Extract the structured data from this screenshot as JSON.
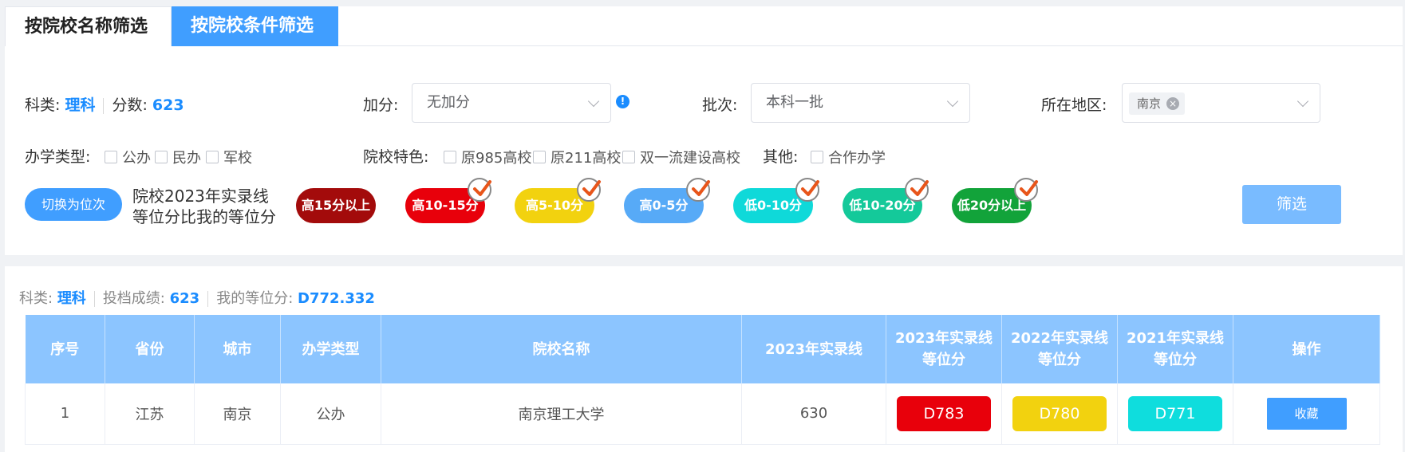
{
  "tabs": [
    "按院校名称筛选",
    "按院校条件筛选"
  ],
  "filters": {
    "subject_label": "科类:",
    "subject_value": "理科",
    "score_label": "分数:",
    "score_value": "623",
    "bonus_label": "加分:",
    "bonus_value": "无加分",
    "batch_label": "批次:",
    "batch_value": "本科一批",
    "region_label": "所在地区:",
    "region_tag": "南京",
    "school_type_label": "办学类型:",
    "school_types": [
      "公办",
      "民办",
      "军校"
    ],
    "feature_label": "院校特色:",
    "features": [
      "原985高校",
      "原211高校",
      "双一流建设高校"
    ],
    "other_label": "其他:",
    "others": [
      "合作办学"
    ]
  },
  "switch_button": "切换为位次",
  "description": [
    "院校2023年实录线",
    "等位分比我的等位分"
  ],
  "chips": [
    {
      "label": "高15分以上",
      "color": "#a30b0b",
      "checked": false
    },
    {
      "label": "高10-15分",
      "color": "#e8000b",
      "checked": true
    },
    {
      "label": "高5-10分",
      "color": "#f2d20f",
      "checked": true
    },
    {
      "label": "高0-5分",
      "color": "#57aaf7",
      "checked": true
    },
    {
      "label": "低0-10分",
      "color": "#0fd9d9",
      "checked": true
    },
    {
      "label": "低10-20分",
      "color": "#14c99a",
      "checked": true
    },
    {
      "label": "低20分以上",
      "color": "#12a33a",
      "checked": true
    }
  ],
  "filter_button": "筛选",
  "summary": {
    "subject_label": "科类:",
    "subject_value": "理科",
    "score_label": "投档成绩:",
    "score_value": "623",
    "rank_label": "我的等位分:",
    "rank_value": "D772.332"
  },
  "table": {
    "headers": [
      "序号",
      "省份",
      "城市",
      "办学类型",
      "院校名称",
      "2023年实录线",
      "2023年实录线\n等位分",
      "2022年实录线\n等位分",
      "2021年实录线\n等位分",
      "操作"
    ],
    "rows": [
      {
        "index": "1",
        "province": "江苏",
        "city": "南京",
        "type": "公办",
        "name": "南京理工大学",
        "line_2023": "630",
        "rank_2023": "D783",
        "rank_2022": "D780",
        "rank_2021": "D771",
        "action": "收藏"
      }
    ]
  },
  "colors": {
    "rank_2023": "#e8000b",
    "rank_2022": "#f2d20f",
    "rank_2021": "#0fdddd",
    "accent": "#409eff"
  }
}
